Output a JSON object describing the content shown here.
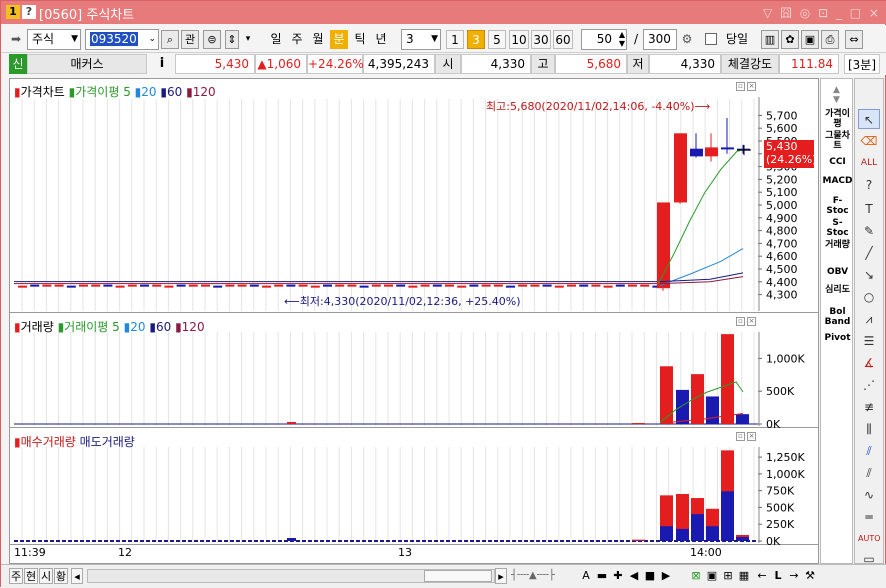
{
  "window": {
    "number": "1",
    "help": "?",
    "title": "[0560] 주식차트",
    "controls": "▽ 囧 ◎ ⊡ _ □ ×"
  },
  "toolbar": {
    "market": "주식",
    "code": "093520",
    "fav_label": "관",
    "periods": [
      "일",
      "주",
      "월",
      "분",
      "틱",
      "년"
    ],
    "active_period": "분",
    "interval_value": "3",
    "quick_intervals": [
      "1",
      "3",
      "5",
      "10",
      "30",
      "60"
    ],
    "active_quick": "3",
    "count": "50",
    "slash": "/",
    "total": "300",
    "today_label": "당일"
  },
  "info": {
    "badge": "신",
    "name": "매커스",
    "i_label": "i",
    "price": "5,430",
    "change": "▲1,060",
    "rate": "+24.26%",
    "volume": "4,395,243",
    "open_label": "시",
    "open": "4,330",
    "high_label": "고",
    "high": "5,680",
    "low_label": "저",
    "low": "4,330",
    "strength_label": "체결강도",
    "strength": "111.84",
    "interval_tag": "[3분]"
  },
  "colors": {
    "up": "#e41e1e",
    "down": "#1a1ab0",
    "ma5": "#2a9a2a",
    "ma20": "#2288dd",
    "ma60": "#1a1a80",
    "ma120": "#8a1a40",
    "title": "#e77a7a"
  },
  "price_panel": {
    "title_main": "가격차트",
    "legend": [
      "가격이평 5",
      "20",
      "60",
      "120"
    ],
    "high_note": "최고:5,680(2020/11/02,14:06, -4.40%)⟶",
    "low_note": "⟵최저:4,330(2020/11/02,12:36, +25.40%)",
    "price_tag_1": "5,430",
    "price_tag_2": "(24.26%)",
    "y_ticks": [
      "5,700",
      "5,600",
      "5,500",
      "5,400",
      "5,300",
      "5,200",
      "5,100",
      "5,000",
      "4,900",
      "4,800",
      "4,700",
      "4,600",
      "4,500",
      "4,400",
      "4,300"
    ]
  },
  "volume_panel": {
    "title_main": "거래량",
    "legend": [
      "거래이평 5",
      "20",
      "60",
      "120"
    ],
    "y_ticks": [
      "1,000K",
      "500K",
      "0K"
    ]
  },
  "buysell_panel": {
    "buy_label": "매수거래량",
    "sell_label": "매도거래량",
    "y_ticks": [
      "1,250K",
      "1,000K",
      "750K",
      "500K",
      "250K",
      "0K"
    ]
  },
  "x_axis": {
    "labels": [
      "11:39",
      "12",
      "13",
      "14:00"
    ]
  },
  "chart_data": [
    {
      "type": "candlestick",
      "title": "가격차트",
      "ylim": [
        4250,
        5750
      ],
      "candles_recent": [
        {
          "o": 4350,
          "h": 5020,
          "l": 4330,
          "c": 5020
        },
        {
          "o": 5020,
          "h": 5560,
          "l": 5010,
          "c": 5560
        },
        {
          "o": 5440,
          "h": 5560,
          "l": 5370,
          "c": 5380
        },
        {
          "o": 5380,
          "h": 5560,
          "l": 5340,
          "c": 5450
        },
        {
          "o": 5450,
          "h": 5680,
          "l": 5400,
          "c": 5440
        },
        {
          "o": 5440,
          "h": 5470,
          "l": 5400,
          "c": 5430
        }
      ],
      "flat_level": 4370
    },
    {
      "type": "bar",
      "title": "거래량",
      "values_recent": [
        15,
        880,
        520,
        760,
        420,
        1370,
        150
      ],
      "unit": "K",
      "ylim": [
        0,
        1250
      ]
    },
    {
      "type": "bar",
      "title": "매수거래량 매도거래량",
      "buy_recent": [
        20,
        680,
        700,
        640,
        480,
        1350,
        90
      ],
      "sell_recent": [
        5,
        220,
        180,
        400,
        220,
        740,
        60
      ],
      "unit": "K",
      "ylim": [
        0,
        1400
      ]
    }
  ],
  "right_indicators": [
    "가격이평",
    "그물차트",
    "CCI",
    "MACD",
    "F-Stoc",
    "S-Stoc",
    "거래량",
    "OBV",
    "심리도",
    "Bol Band",
    "Pivot"
  ],
  "bottom": {
    "tabs": [
      "주",
      "현",
      "시",
      "황"
    ]
  }
}
